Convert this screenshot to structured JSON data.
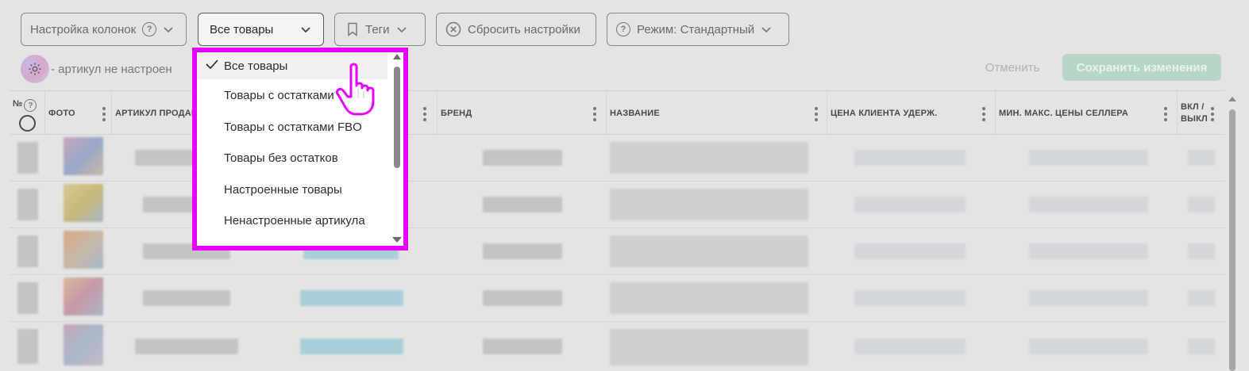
{
  "toolbar": {
    "columns_label": "Настройка колонок",
    "filter_label": "Все товары",
    "tags_label": "Теги",
    "reset_label": "Сбросить настройки",
    "mode_label": "Режим: Стандартный"
  },
  "notice": {
    "text": "- артикул не настроен"
  },
  "actions": {
    "cancel_label": "Отменить",
    "save_label": "Сохранить изменения"
  },
  "table": {
    "headers": {
      "num": "№",
      "photo": "ФОТО",
      "article": "АРТИКУЛ ПРОДАВ",
      "brand": "БРЕНД",
      "name": "НАЗВАНИЕ",
      "price": "ЦЕНА КЛИЕНТА УДЕРЖ.",
      "minmax": "МИН. МАКС. ЦЕНЫ СЕЛЛЕРА",
      "toggle_1": "ВКЛ /",
      "toggle_2": "ВЫКЛ"
    }
  },
  "dropdown": {
    "items": [
      {
        "label": "Все товары",
        "selected": true
      },
      {
        "label": "Товары с остатками"
      },
      {
        "label": "Товары с остатками FBO"
      },
      {
        "label": "Товары без остатков"
      },
      {
        "label": "Настроенные товары"
      },
      {
        "label": "Ненастроенные артикула"
      }
    ]
  },
  "colors": {
    "highlight": "#e600ff",
    "save_button": "#b7d6c6"
  }
}
